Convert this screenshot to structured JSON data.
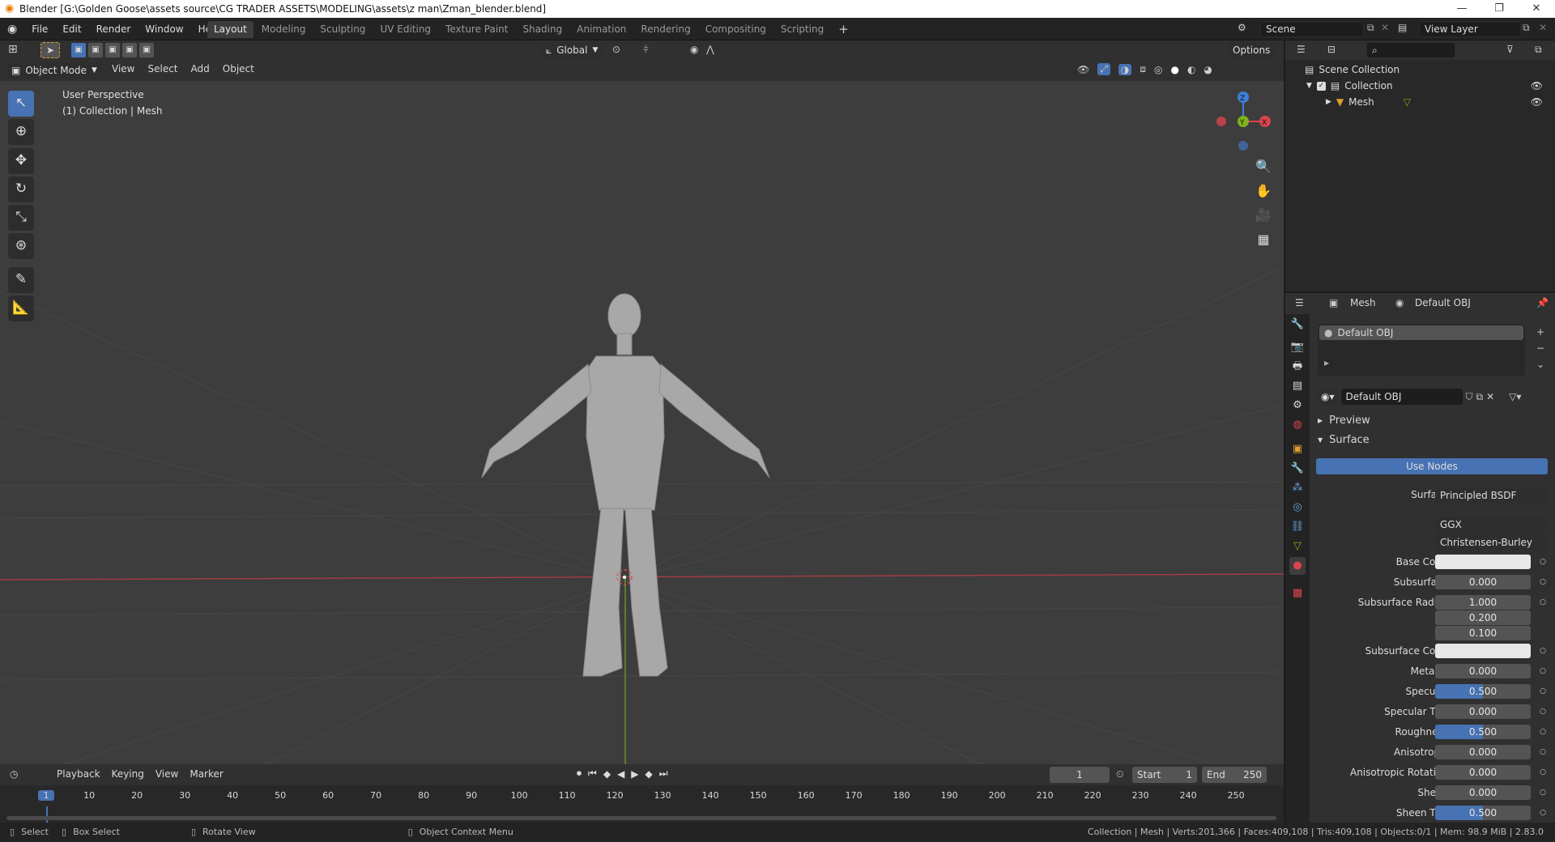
{
  "window": {
    "title": "Blender [G:\\Golden Goose\\assets source\\CG TRADER ASSETS\\MODELING\\assets\\z man\\Zman_blender.blend]",
    "minimize": "—",
    "restore": "❐",
    "close": "✕"
  },
  "menu": [
    "File",
    "Edit",
    "Render",
    "Window",
    "Help"
  ],
  "workspaces": [
    "Layout",
    "Modeling",
    "Sculpting",
    "UV Editing",
    "Texture Paint",
    "Shading",
    "Animation",
    "Rendering",
    "Compositing",
    "Scripting"
  ],
  "workspace_add": "+",
  "scene": {
    "label": "Scene",
    "view_layer": "View Layer"
  },
  "viewport": {
    "orientation": "Global",
    "options": "Options",
    "mode": "Object Mode",
    "menus": [
      "View",
      "Select",
      "Add",
      "Object"
    ],
    "overlay_line1": "User Perspective",
    "overlay_line2": "(1) Collection | Mesh",
    "gizmo": {
      "z": "Z",
      "x": "X",
      "y": "Y"
    }
  },
  "timeline": {
    "menus": [
      "Playback",
      "Keying",
      "View",
      "Marker"
    ],
    "current_frame": "1",
    "start_label": "Start",
    "start": "1",
    "end_label": "End",
    "end": "250",
    "ticks": [
      "1",
      "10",
      "20",
      "30",
      "40",
      "50",
      "60",
      "70",
      "80",
      "90",
      "100",
      "110",
      "120",
      "130",
      "140",
      "150",
      "160",
      "170",
      "180",
      "190",
      "200",
      "210",
      "220",
      "230",
      "240",
      "250"
    ]
  },
  "status": {
    "select": "Select",
    "box_select": "Box Select",
    "rotate": "Rotate View",
    "context": "Object Context Menu",
    "info": "Collection | Mesh | Verts:201,366 | Faces:409,108 | Tris:409,108 | Objects:0/1 | Mem: 98.9 MiB | 2.83.0"
  },
  "outliner": {
    "scene_collection": "Scene Collection",
    "collection": "Collection",
    "mesh": "Mesh"
  },
  "properties": {
    "header_object": "Mesh",
    "header_material": "Default OBJ",
    "slot": "Default OBJ",
    "material_name": "Default OBJ",
    "preview": "Preview",
    "surface_panel": "Surface",
    "use_nodes": "Use Nodes",
    "surface_label": "Surface",
    "surface_value": "Principled BSDF",
    "distribution": "GGX",
    "subsurface_method": "Christensen-Burley",
    "fields": [
      {
        "label": "Base Color",
        "value": "",
        "style": "white"
      },
      {
        "label": "Subsurface",
        "value": "0.000",
        "style": ""
      },
      {
        "label": "Subsurface Radius",
        "value": "1.000",
        "style": ""
      },
      {
        "label": "",
        "value": "0.200",
        "style": ""
      },
      {
        "label": "",
        "value": "0.100",
        "style": ""
      },
      {
        "label": "Subsurface Color",
        "value": "",
        "style": "white"
      },
      {
        "label": "Metallic",
        "value": "0.000",
        "style": ""
      },
      {
        "label": "Specular",
        "value": "0.500",
        "style": "blue"
      },
      {
        "label": "Specular Tint",
        "value": "0.000",
        "style": ""
      },
      {
        "label": "Roughness",
        "value": "0.500",
        "style": "blue"
      },
      {
        "label": "Anisotropic",
        "value": "0.000",
        "style": ""
      },
      {
        "label": "Anisotropic Rotation",
        "value": "0.000",
        "style": ""
      },
      {
        "label": "Sheen",
        "value": "0.000",
        "style": ""
      },
      {
        "label": "Sheen Tint",
        "value": "0.500",
        "style": "blue"
      }
    ]
  },
  "colors": {
    "accent": "#4772b3",
    "x_axis": "#d9444f",
    "y_axis": "#7eb31b",
    "z_axis": "#3f7fd9"
  }
}
